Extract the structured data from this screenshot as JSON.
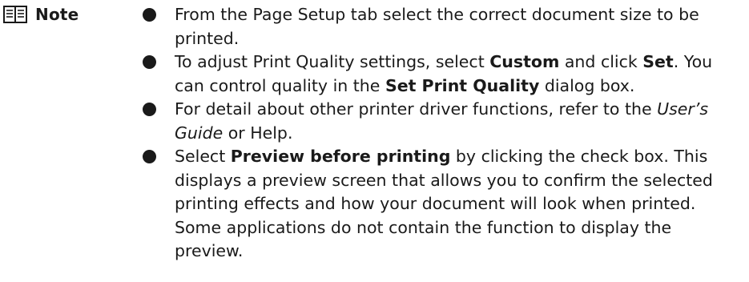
{
  "note": {
    "label": "Note",
    "icon": "note-book-icon"
  },
  "items": [
    {
      "text_1": "From the Page Setup tab select the correct document size to be printed."
    },
    {
      "text_1": "To adjust Print Quality settings, select ",
      "bold_1": "Custom",
      "text_2": " and click ",
      "bold_2": "Set",
      "text_3": ". You can control quality in the ",
      "bold_3": "Set Print Quality",
      "text_4": " dialog box."
    },
    {
      "text_1": "For detail about other printer driver functions, refer to the ",
      "italic_1": "User’s Guide",
      "text_2": " or Help."
    },
    {
      "text_1": "Select ",
      "bold_1": "Preview before printing",
      "text_2": " by clicking the check box. This displays a preview screen that allows you to confirm the selected printing effects and how your document will look when printed. Some applications do not contain the function to display the preview."
    }
  ]
}
